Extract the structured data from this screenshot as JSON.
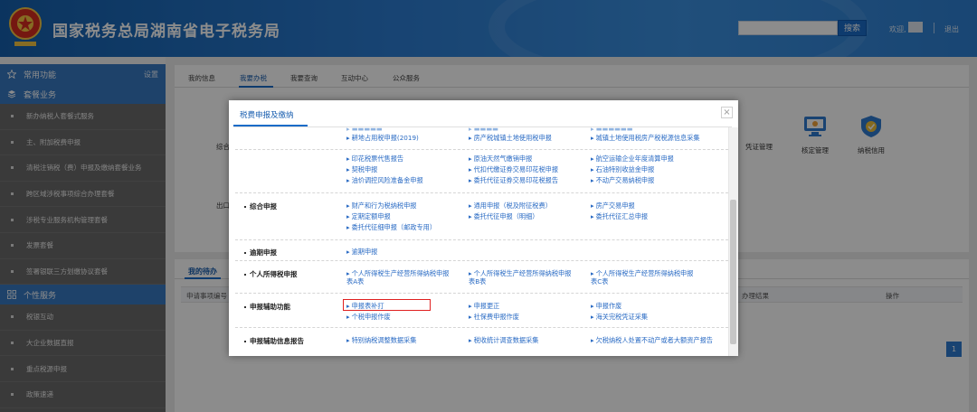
{
  "header": {
    "title": "国家税务总局湖南省电子税务局",
    "search_label": "搜索",
    "welcome_label": "欢迎,",
    "logout_label": "退出"
  },
  "sidebar": {
    "sections": [
      {
        "label": "常用功能",
        "right_label": "设置"
      },
      {
        "label": "套餐业务"
      },
      {
        "label": "个性服务"
      }
    ],
    "package_items": [
      "新办纳税人套餐式服务",
      "主、附加税费申报",
      "清税注销税（费）申报及缴纳套餐业务",
      "跨区域涉税事项综合办理套餐",
      "涉税专业服务机构管理套餐",
      "发票套餐",
      "签署银联三方划缴协议套餐"
    ],
    "personal_items": [
      "税银互动",
      "大企业数据直报",
      "重点税源申报",
      "政策速递"
    ]
  },
  "main": {
    "tabs": [
      "我的信息",
      "我要办税",
      "我要查询",
      "互动中心",
      "公众服务"
    ],
    "active_tab": "我要办税",
    "left_labels": [
      "综合",
      "出口"
    ],
    "tiles": [
      {
        "label": "凭证管理",
        "icon": "certificate-icon"
      },
      {
        "label": "核定管理",
        "icon": "monitor-icon"
      },
      {
        "label": "纳税信用",
        "icon": "shield-icon"
      }
    ],
    "todo_tab": "我的待办",
    "table_headers": [
      "申请事项编号",
      "办理结果",
      "操作"
    ],
    "page_number": "1"
  },
  "modal": {
    "title": "税费申报及缴纳",
    "close_label": "×",
    "top_rows": [
      [
        "耕地占用税申报(2019)",
        "房产税城镇土地使用税申报",
        "城镇土地使用税房产税税源信息采集"
      ],
      [
        "印花税票代售报告",
        "原油天然气缴销申报",
        "航空运输企业年度清算申报"
      ],
      [
        "契税申报",
        "代扣代缴证券交易印花税申报",
        "石油特别收益金申报"
      ],
      [
        "油价调控风险准备金申报",
        "委托代征证券交易印花税报告",
        "不动产交易纳税申报"
      ]
    ],
    "sections": [
      {
        "label": "综合申报",
        "links": [
          "财产和行为税纳税申报",
          "通用申报（税及附征税费）",
          "房产交易申报",
          "定期定额申报",
          "委托代征申报（明细）",
          "委托代征汇总申报",
          "委托代征细申报（邮政专用）"
        ]
      },
      {
        "label": "逾期申报",
        "links": [
          "逾期申报"
        ]
      },
      {
        "label": "个人所得税申报",
        "links": [
          "个人所得税生产经营所得纳税申报表A表",
          "个人所得税生产经营所得纳税申报表B表",
          "个人所得税生产经营所得纳税申报表C表"
        ]
      },
      {
        "label": "申报辅助功能",
        "links": [
          "申报表补打",
          "申报更正",
          "申报作废",
          "个税申报作废",
          "社保费申报作废",
          "海关完税凭证采集"
        ]
      },
      {
        "label": "申报辅助信息报告",
        "links": [
          "特别纳税调整数据采集",
          "税收统计调查数据采集",
          "欠税纳税人处置不动产或者大额资产报告"
        ]
      }
    ],
    "highlighted_link": "财产和行为税纳税申报"
  },
  "colors": {
    "header_blue": "#2c7cd1",
    "sidebar_blue": "#3778c2",
    "link_blue": "#2a6bc4",
    "highlight_red": "#e02020"
  }
}
